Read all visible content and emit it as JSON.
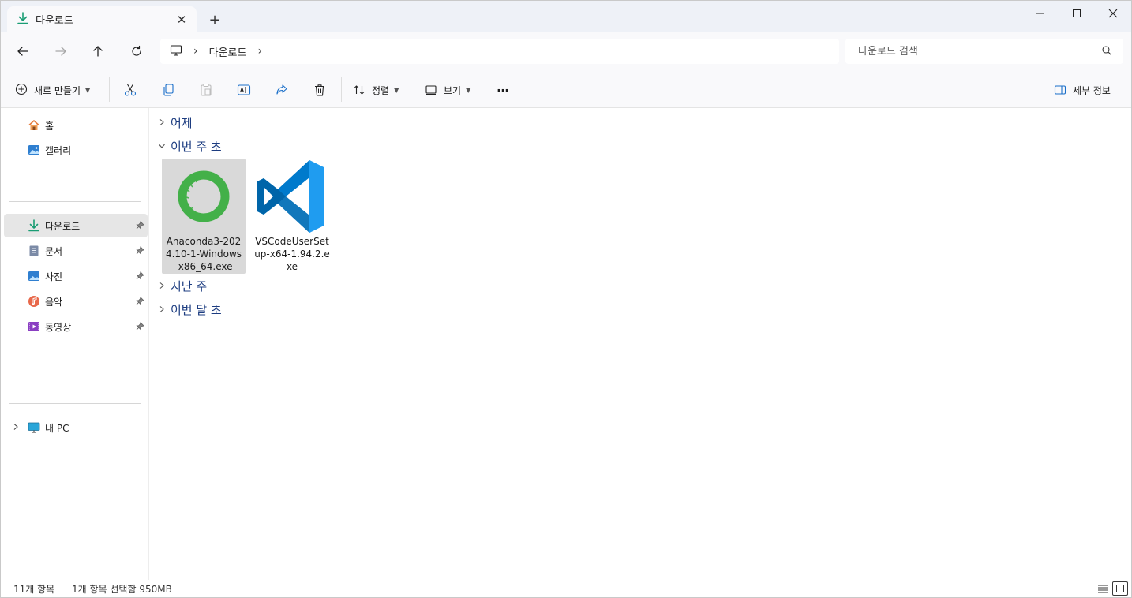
{
  "window": {
    "tab_title": "다운로드",
    "new_tab_glyph": "+",
    "close_tab_glyph": "✕"
  },
  "navigation": {
    "breadcrumb": [
      "다운로드"
    ],
    "search_placeholder": "다운로드 검색"
  },
  "toolbar": {
    "new_label": "새로 만들기",
    "sort_label": "정렬",
    "view_label": "보기",
    "more_label": "···",
    "details_label": "세부 정보"
  },
  "sidebar": {
    "top_items": [
      {
        "label": "홈",
        "icon": "home-icon"
      },
      {
        "label": "갤러리",
        "icon": "gallery-icon"
      }
    ],
    "quick_access": [
      {
        "label": "다운로드",
        "icon": "download-icon",
        "pinned": true,
        "selected": true
      },
      {
        "label": "문서",
        "icon": "document-icon",
        "pinned": true
      },
      {
        "label": "사진",
        "icon": "pictures-icon",
        "pinned": true
      },
      {
        "label": "음악",
        "icon": "music-icon",
        "pinned": true
      },
      {
        "label": "동영상",
        "icon": "video-icon",
        "pinned": true
      }
    ],
    "this_pc": {
      "label": "내 PC",
      "icon": "pc-icon"
    }
  },
  "content": {
    "groups": [
      {
        "label": "어제",
        "expanded": false
      },
      {
        "label": "이번 주 초",
        "expanded": true
      },
      {
        "label": "지난 주",
        "expanded": false
      },
      {
        "label": "이번 달 초",
        "expanded": false
      }
    ],
    "files": [
      {
        "name": "Anaconda3-2024.10-1-Windows-x86_64.exe",
        "icon": "anaconda-icon",
        "selected": true
      },
      {
        "name": "VSCodeUserSetup-x64-1.94.2.exe",
        "icon": "vscode-icon",
        "selected": false
      }
    ]
  },
  "status": {
    "item_count": "11개 항목",
    "selection": "1개 항목 선택함 950MB"
  },
  "colors": {
    "titlebar_bg": "#eef1f7",
    "group_header": "#1c3c80",
    "selection_bg": "#d9d9d9",
    "download_accent": "#1a9d74",
    "anaconda_green": "#43b049",
    "vscode_blue": "#0078d4"
  }
}
